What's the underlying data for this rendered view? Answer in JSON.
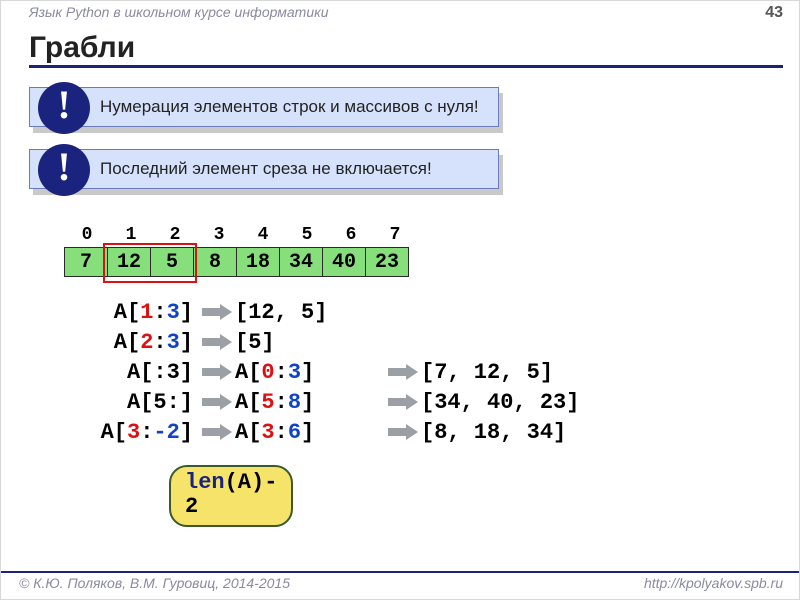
{
  "header": {
    "course": "Язык Python в школьном курсе информатики",
    "page": "43"
  },
  "title": "Грабли",
  "callouts": {
    "c1": {
      "bang": "!",
      "text": "Нумерация элементов строк и массивов с нуля!"
    },
    "c2": {
      "bang": "!",
      "text": "Последний элемент среза не включается!"
    }
  },
  "array": {
    "indices": [
      "0",
      "1",
      "2",
      "3",
      "4",
      "5",
      "6",
      "7"
    ],
    "values": [
      "7",
      "12",
      "5",
      "8",
      "18",
      "34",
      "40",
      "23"
    ]
  },
  "slices": {
    "r1": {
      "lhs_pre": "A[",
      "a": "1",
      "colon": ":",
      "b": "3",
      "lhs_post": "]",
      "mid": "[12, 5]",
      "res": ""
    },
    "r2": {
      "lhs_pre": "A[",
      "a": "2",
      "colon": ":",
      "b": "3",
      "lhs_post": "]",
      "mid": "[5]",
      "res": ""
    },
    "r3": {
      "lhs_plain": "A[:3]",
      "mid_pre": "A[",
      "ma": "0",
      "mc": ":",
      "mb": "3",
      "mid_post": "]",
      "res": "[7, 12, 5]"
    },
    "r4": {
      "lhs_plain": "A[5:]",
      "mid_pre": "A[",
      "ma": "5",
      "mc": ":",
      "mb": "8",
      "mid_post": "]",
      "res": "[34, 40, 23]"
    },
    "r5": {
      "lhs_pre": "A[",
      "a": "3",
      "colon": ":",
      "b": "-2",
      "lhs_post": "]",
      "mid_pre": "A[",
      "ma": "3",
      "mc": ":",
      "mb": "6",
      "mid_post": "]",
      "res": "[8, 18, 34]"
    }
  },
  "len_bubble": {
    "kw": "len",
    "rest1": "(A)-",
    "rest2": "2"
  },
  "footer": {
    "copyright": "© К.Ю. Поляков, В.М. Гуровиц, 2014-2015",
    "url": "http://kpolyakov.spb.ru"
  }
}
